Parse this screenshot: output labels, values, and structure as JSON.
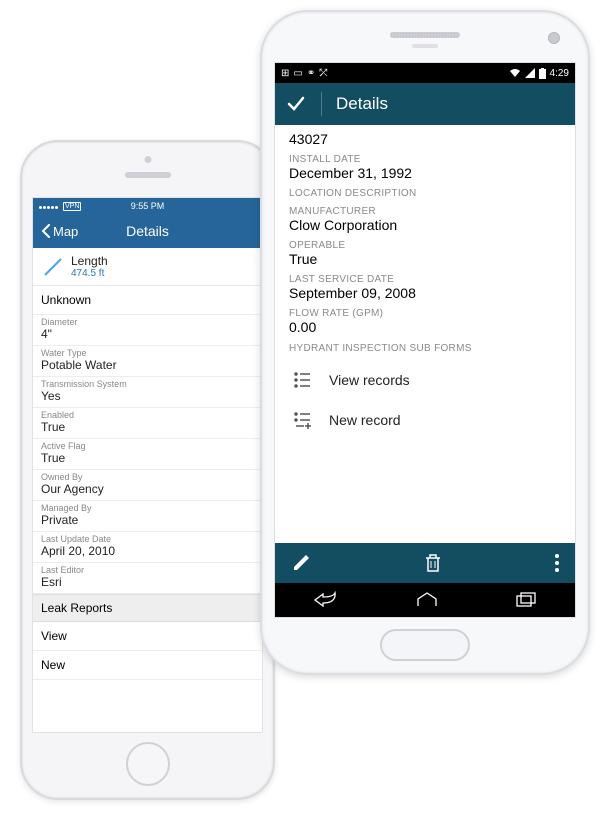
{
  "iphone": {
    "statusbar_time": "9:55 PM",
    "navbar_back": "Map",
    "navbar_title": "Details",
    "feature_title": "Length",
    "feature_subtitle": "474.5 ft",
    "unknown_row": "Unknown",
    "fields": [
      {
        "label": "Diameter",
        "value": "4\""
      },
      {
        "label": "Water Type",
        "value": "Potable Water"
      },
      {
        "label": "Transmission System",
        "value": "Yes"
      },
      {
        "label": "Enabled",
        "value": "True"
      },
      {
        "label": "Active Flag",
        "value": "True"
      },
      {
        "label": "Owned By",
        "value": "Our Agency"
      },
      {
        "label": "Managed By",
        "value": "Private"
      },
      {
        "label": "Last Update Date",
        "value": "April 20, 2010"
      },
      {
        "label": "Last Editor",
        "value": "Esri"
      }
    ],
    "section_header": "Leak Reports",
    "row_view": "View",
    "row_new": "New"
  },
  "android": {
    "statusbar_time": "4:29",
    "actionbar_title": "Details",
    "top_value": "43027",
    "fields": [
      {
        "label": "INSTALL DATE",
        "value": "December 31, 1992"
      },
      {
        "label": "LOCATION DESCRIPTION",
        "value": ""
      },
      {
        "label": "MANUFACTURER",
        "value": "Clow Corporation"
      },
      {
        "label": "OPERABLE",
        "value": "True"
      },
      {
        "label": "LAST SERVICE DATE",
        "value": "September 09, 2008"
      },
      {
        "label": "FLOW RATE (GPM)",
        "value": "0.00"
      }
    ],
    "subforms_header": "HYDRANT INSPECTION SUB FORMS",
    "view_records": "View records",
    "new_record": "New record"
  }
}
